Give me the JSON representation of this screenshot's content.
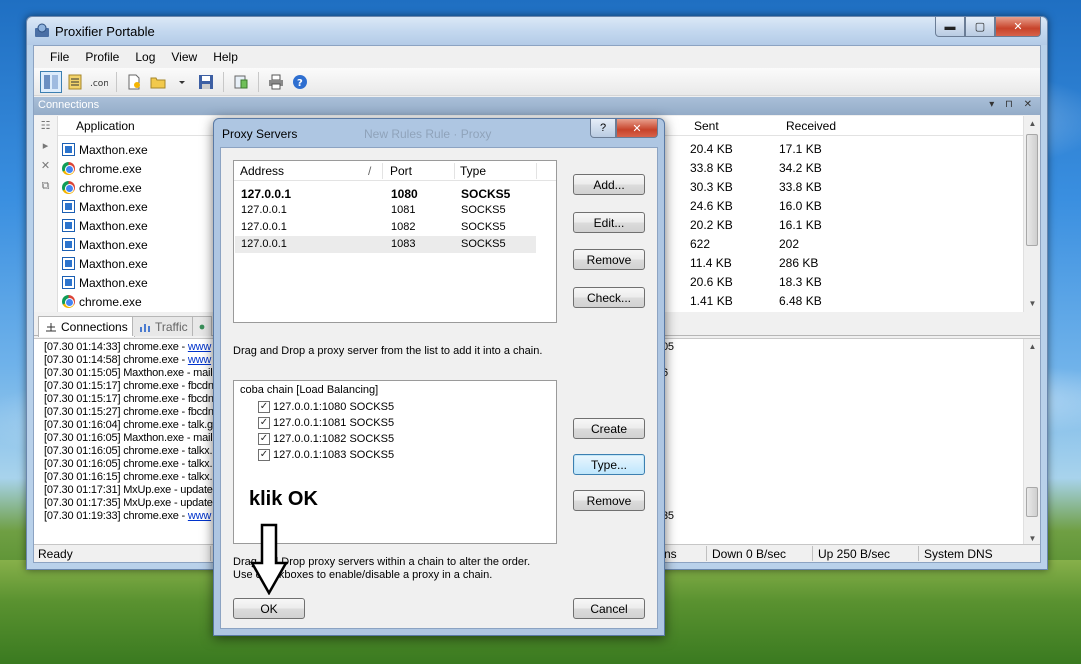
{
  "window": {
    "title": "Proxifier Portable",
    "controls": {
      "minimize": "▬",
      "maximize": "▢",
      "close": "✕"
    }
  },
  "menu": [
    "File",
    "Profile",
    "Log",
    "View",
    "Help"
  ],
  "panel": {
    "title": "Connections",
    "controls": "▾ ⊓ ✕"
  },
  "connections": {
    "headers": {
      "application": "Application",
      "sent": "Sent",
      "received": "Received"
    },
    "rows": [
      {
        "app": "Maxthon.exe",
        "icon": "maxthon-icon",
        "sent": "20.4 KB",
        "received": "17.1 KB"
      },
      {
        "app": "chrome.exe",
        "icon": "chrome-icon",
        "sent": "33.8 KB",
        "received": "34.2 KB"
      },
      {
        "app": "chrome.exe",
        "icon": "chrome-icon",
        "sent": "30.3 KB",
        "received": "33.8 KB"
      },
      {
        "app": "Maxthon.exe",
        "icon": "maxthon-icon",
        "sent": "24.6 KB",
        "received": "16.0 KB"
      },
      {
        "app": "Maxthon.exe",
        "icon": "maxthon-icon",
        "sent": "20.2 KB",
        "received": "16.1 KB"
      },
      {
        "app": "Maxthon.exe",
        "icon": "maxthon-icon",
        "sent": "622",
        "received": "202"
      },
      {
        "app": "Maxthon.exe",
        "icon": "maxthon-icon",
        "sent": "11.4 KB",
        "received": "286 KB"
      },
      {
        "app": "Maxthon.exe",
        "icon": "maxthon-icon",
        "sent": "20.6 KB",
        "received": "18.3 KB"
      },
      {
        "app": "chrome.exe",
        "icon": "chrome-icon",
        "sent": "1.41 KB",
        "received": "6.48 KB"
      }
    ]
  },
  "tabs": {
    "connections": "Connections",
    "traffic": "Traffic"
  },
  "log": [
    {
      "time": "[07.30 01:14:33]",
      "text": "chrome.exe - ",
      "link": "www",
      "right": "05"
    },
    {
      "time": "[07.30 01:14:58]",
      "text": "chrome.exe - ",
      "link": "www",
      "right": ""
    },
    {
      "time": "[07.30 01:15:05]",
      "text": "Maxthon.exe - mail",
      "link": "",
      "right": "6"
    },
    {
      "time": "[07.30 01:15:17]",
      "text": "chrome.exe - fbcdn",
      "link": "",
      "right": ""
    },
    {
      "time": "[07.30 01:15:17]",
      "text": "chrome.exe - fbcdn",
      "link": "",
      "right": ""
    },
    {
      "time": "[07.30 01:15:27]",
      "text": "chrome.exe - fbcdn",
      "link": "",
      "right": ""
    },
    {
      "time": "[07.30 01:16:04]",
      "text": "chrome.exe - talk.g",
      "link": "",
      "right": ""
    },
    {
      "time": "[07.30 01:16:05]",
      "text": "Maxthon.exe - mail",
      "link": "",
      "right": ""
    },
    {
      "time": "[07.30 01:16:05]",
      "text": "chrome.exe - talkx.",
      "link": "",
      "right": ""
    },
    {
      "time": "[07.30 01:16:05]",
      "text": "chrome.exe - talkx.",
      "link": "",
      "right": ""
    },
    {
      "time": "[07.30 01:16:15]",
      "text": "chrome.exe - talkx.",
      "link": "",
      "right": ""
    },
    {
      "time": "[07.30 01:17:31]",
      "text": "MxUp.exe - update",
      "link": "",
      "right": ""
    },
    {
      "time": "[07.30 01:17:35]",
      "text": "MxUp.exe - update",
      "link": "",
      "right": ""
    },
    {
      "time": "[07.30 01:19:33]",
      "text": "chrome.exe - ",
      "link": "www",
      "right": "35"
    }
  ],
  "status": {
    "ready": "Ready",
    "ns": "ns",
    "down": "Down 0 B/sec",
    "up": "Up 250 B/sec",
    "dns": "System DNS"
  },
  "dialog": {
    "title": "Proxy Servers",
    "ghost_text": "New Rules     Rule · Proxy",
    "help": "?",
    "close": "✕",
    "servers": {
      "headers": {
        "address": "Address",
        "sort": "/",
        "port": "Port",
        "type": "Type"
      },
      "rows": [
        {
          "address": "127.0.0.1",
          "port": "1080",
          "type": "SOCKS5"
        },
        {
          "address": "127.0.0.1",
          "port": "1081",
          "type": "SOCKS5"
        },
        {
          "address": "127.0.0.1",
          "port": "1082",
          "type": "SOCKS5"
        },
        {
          "address": "127.0.0.1",
          "port": "1083",
          "type": "SOCKS5"
        }
      ]
    },
    "buttons": {
      "add": "Add...",
      "edit": "Edit...",
      "remove": "Remove",
      "check": "Check...",
      "create": "Create",
      "type": "Type...",
      "remove2": "Remove",
      "ok": "OK",
      "cancel": "Cancel"
    },
    "drag_hint": "Drag and Drop a proxy server from the list to add it into a chain.",
    "chain": {
      "title": "coba chain [Load Balancing]",
      "items": [
        {
          "label": "127.0.0.1:1080 SOCKS5",
          "checked": "✓"
        },
        {
          "label": "127.0.0.1:1081 SOCKS5",
          "checked": "✓"
        },
        {
          "label": "127.0.0.1:1082 SOCKS5",
          "checked": "✓"
        },
        {
          "label": "127.0.0.1:1083 SOCKS5",
          "checked": "✓"
        }
      ]
    },
    "order_hint_1": "Drag and Drop proxy servers within a chain to alter the order.",
    "order_hint_2": "Use checkboxes to enable/disable a proxy in a chain."
  },
  "annotation": "klik OK"
}
